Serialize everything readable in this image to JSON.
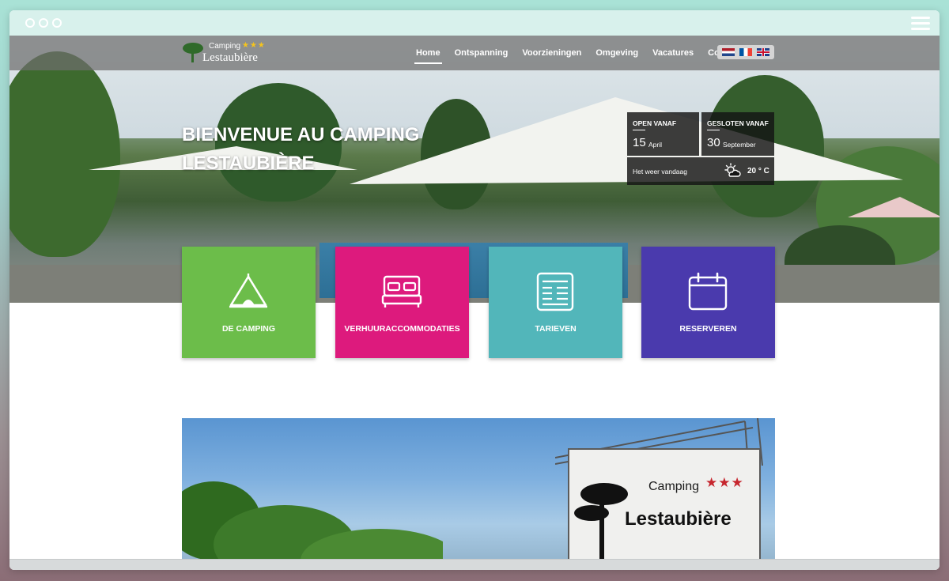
{
  "window": {
    "menu_icon": "hamburger-menu-icon"
  },
  "nav": {
    "logo": {
      "small": "Camping",
      "stars": "★★★",
      "name": "Lestaubière"
    },
    "links": [
      "Home",
      "Ontspanning",
      "Voorzieningen",
      "Omgeving",
      "Vacatures",
      "Contact"
    ],
    "active_index": 0,
    "languages": [
      "nl-flag",
      "fr-flag",
      "gb-flag"
    ]
  },
  "hero": {
    "title_line1": "BIENVENUE AU CAMPING",
    "title_line2": "LESTAUBIÈRE"
  },
  "info": {
    "open_label": "OPEN VANAF",
    "open_day": "15",
    "open_month": "April",
    "close_label": "GESLOTEN VANAF",
    "close_day": "30",
    "close_month": "September",
    "weather_label": "Het weer vandaag",
    "weather_icon": "partly-cloudy-sun-icon",
    "weather_temp": "20 ° C"
  },
  "cards": [
    {
      "label": "DE CAMPING",
      "icon": "tent-icon",
      "color": "#6cbd4a"
    },
    {
      "label": "VERHUURACCOMMODATIES",
      "icon": "bed-icon",
      "color": "#dd1a7d"
    },
    {
      "label": "TARIEVEN",
      "icon": "price-list-icon",
      "color": "#52b6ba"
    },
    {
      "label": "RESERVEREN",
      "icon": "calendar-icon",
      "color": "#4a3aad"
    }
  ],
  "photo": {
    "sign_camping": "Camping",
    "sign_stars": "★★★",
    "sign_name": "Lestaubière"
  }
}
